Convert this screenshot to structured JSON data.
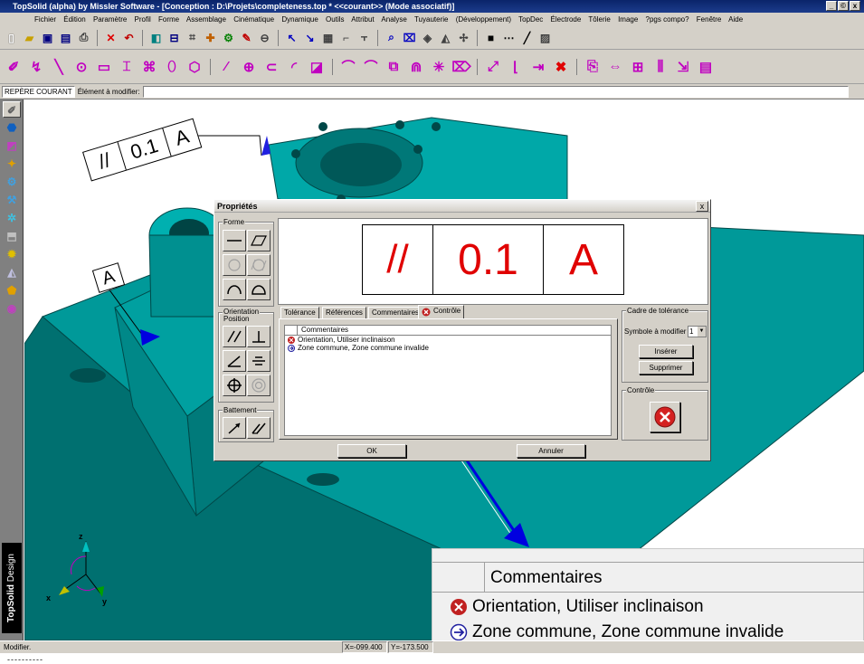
{
  "window": {
    "title": "TopSolid (alpha) by Missler Software - [Conception : D:\\Projets\\completeness.top *  <<courant>> (Mode associatif)]",
    "controls": [
      "_",
      "©",
      "x"
    ]
  },
  "menu": [
    "Fichier",
    "Édition",
    "Paramètre",
    "Profil",
    "Forme",
    "Assemblage",
    "Cinématique",
    "Dynamique",
    "Outils",
    "Attribut",
    "Analyse",
    "Tuyauterie",
    "(Développement)",
    "TopDec",
    "Électrode",
    "Tôlerie",
    "Image",
    "?pgs compo?",
    "Fenêtre",
    "Aide"
  ],
  "coordbar": {
    "repere": "REPÈRE COURANT",
    "element_label": "Élément à modifier:",
    "element_value": ""
  },
  "brand": {
    "name": "TopSolid",
    "suffix": "Design"
  },
  "viewport": {
    "callout1": {
      "symbol": "//",
      "value": "0.1",
      "datum": "A"
    },
    "callout2": {
      "datum": "A"
    },
    "axes": {
      "x": "x",
      "y": "y",
      "z": "z"
    }
  },
  "dialog": {
    "title": "Propriétés",
    "close": "x",
    "forme_label": "Forme",
    "orientation_label": "Orientation\nPosition",
    "battement_label": "Battement",
    "preview": {
      "symbol": "//",
      "value": "0.1",
      "datum": "A"
    },
    "tabs": [
      "Tolérance",
      "Références",
      "Commentaires",
      "Contrôle"
    ],
    "list_header": "Commentaires",
    "list_items": [
      {
        "icon": "error",
        "text": "Orientation, Utiliser inclinaison"
      },
      {
        "icon": "info",
        "text": "Zone commune, Zone commune invalide"
      }
    ],
    "cadre": {
      "label": "Cadre de tolérance",
      "symbole_label": "Symbole à modifier >",
      "symbole_value": "1",
      "insert": "Insérer",
      "delete": "Supprimer"
    },
    "controle_label": "Contrôle",
    "ok": "OK",
    "cancel": "Annuler"
  },
  "zoom": {
    "header": "Commentaires",
    "items": [
      {
        "icon": "error",
        "text": "Orientation, Utiliser inclinaison"
      },
      {
        "icon": "info",
        "text": "Zone commune, Zone commune invalide"
      }
    ]
  },
  "status": {
    "text": "Modifier.",
    "x": "X=-099.400",
    "y": "Y=-173.500",
    "dashes": "----------"
  },
  "colors": {
    "part": "#008b8b",
    "part_dark": "#005f5f",
    "tolerance_red": "#e00000",
    "arrow_blue": "#0000e0",
    "titlebar": "#0a246a"
  }
}
